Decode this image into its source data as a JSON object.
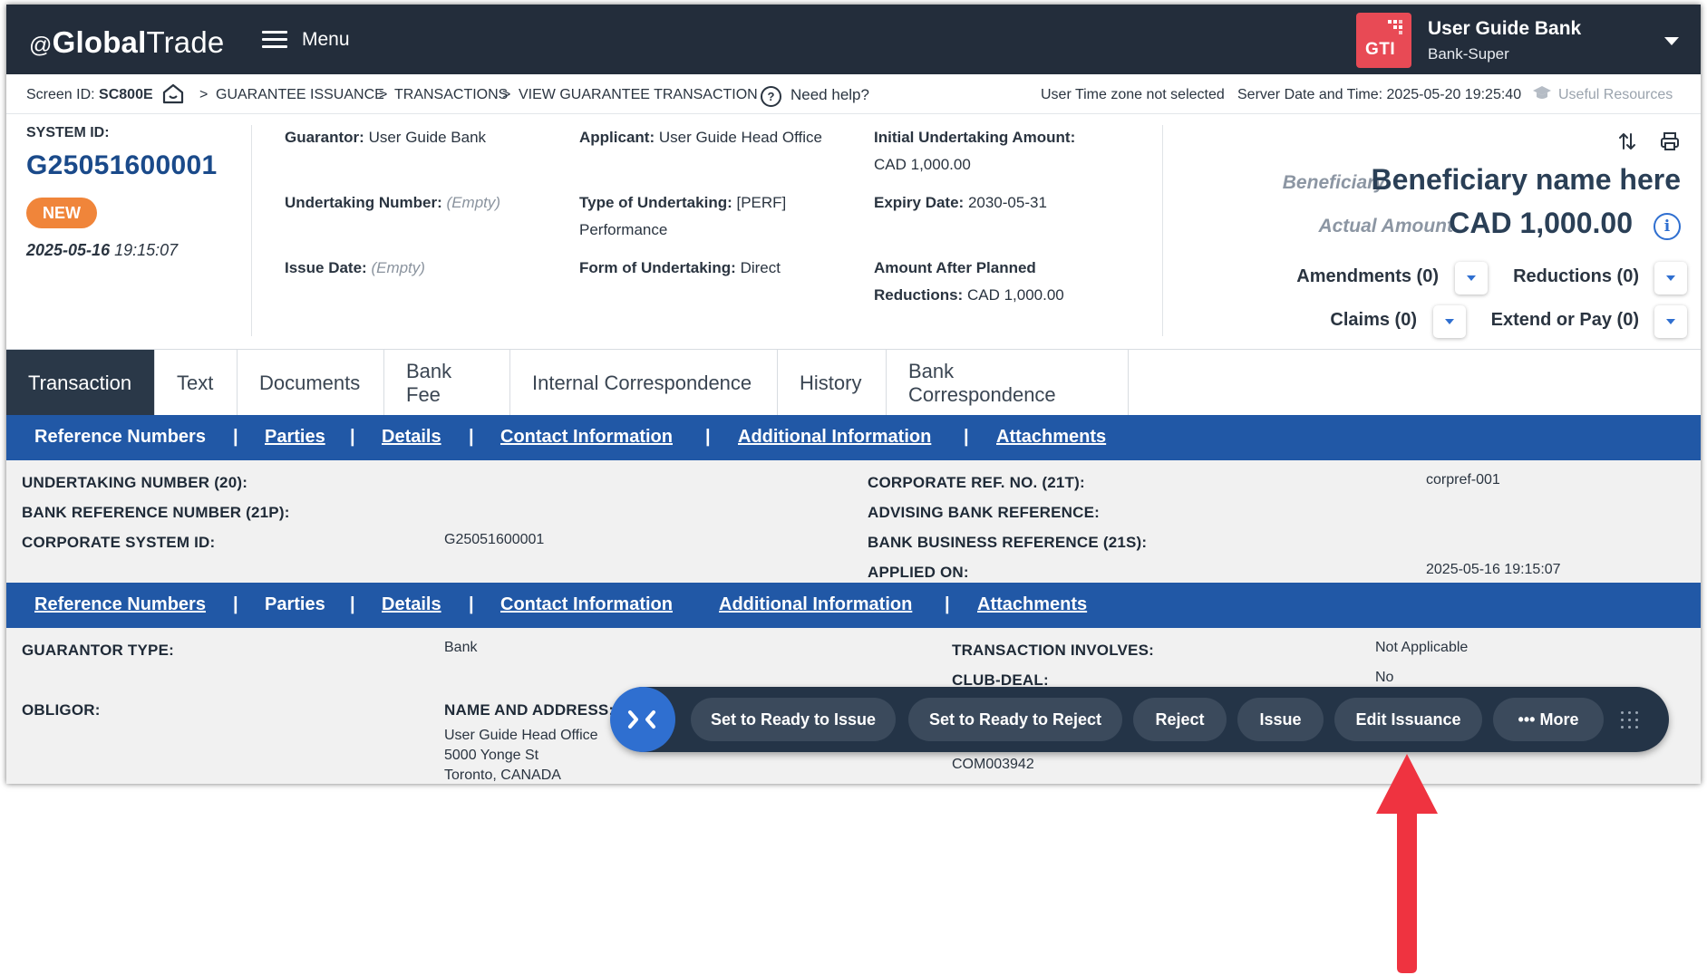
{
  "header": {
    "logo_at": "@",
    "logo_bold": "Global",
    "logo_regular": "Trade",
    "menu_label": "Menu",
    "gti_label": "GTI",
    "user_name": "User Guide Bank",
    "user_role": "Bank-Super"
  },
  "breadcrumb": {
    "screen_id_label": "Screen ID:",
    "screen_id": "SC800E",
    "items": [
      "GUARANTEE ISSUANCE",
      "TRANSACTIONS",
      "VIEW GUARANTEE TRANSACTION"
    ],
    "separator": ">",
    "help": "Need help?",
    "timezone": "User Time zone not selected",
    "server_time": "Server Date and Time: 2025-05-20 19:25:40",
    "resources": "Useful Resources"
  },
  "summary": {
    "system_id_label": "SYSTEM ID:",
    "system_id": "G25051600001",
    "status": "NEW",
    "date": "2025-05-16",
    "time": "19:15:07",
    "guarantor_label": "Guarantor:",
    "guarantor": "User Guide Bank",
    "undertaking_number_label": "Undertaking Number:",
    "undertaking_number": "(Empty)",
    "issue_date_label": "Issue Date:",
    "issue_date": "(Empty)",
    "applicant_label": "Applicant:",
    "applicant": "User Guide Head Office",
    "type_label": "Type of Undertaking:",
    "type_line1": "[PERF]",
    "type_line2": "Performance",
    "form_label": "Form of Undertaking:",
    "form": "Direct",
    "initial_amount_label": "Initial Undertaking Amount:",
    "initial_amount": "CAD 1,000.00",
    "expiry_label": "Expiry Date:",
    "expiry": "2030-05-31",
    "after_planned_label_1": "Amount After Planned",
    "after_planned_label_2": "Reductions:",
    "after_planned": "CAD 1,000.00",
    "beneficiary_label": "Beneficiary",
    "beneficiary": "Beneficiary name here",
    "actual_amount_label": "Actual Amount",
    "actual_amount": "CAD 1,000.00",
    "amendments": "Amendments (0)",
    "reductions": "Reductions (0)",
    "claims": "Claims (0)",
    "extend_or_pay": "Extend or Pay (0)"
  },
  "tabs": [
    "Transaction",
    "Text",
    "Documents",
    "Bank Fee",
    "Internal Correspondence",
    "History",
    "Bank Correspondence"
  ],
  "active_tab": "Transaction",
  "section_nav": [
    "Reference Numbers",
    "Parties",
    "Details",
    "Contact Information",
    "Additional Information",
    "Attachments"
  ],
  "reference_numbers": {
    "undertaking_number_label": "UNDERTAKING NUMBER (20):",
    "undertaking_number": "",
    "bank_reference_label": "BANK REFERENCE NUMBER (21P):",
    "bank_reference": "",
    "corporate_system_id_label": "CORPORATE SYSTEM ID:",
    "corporate_system_id": "G25051600001",
    "corporate_ref_label": "CORPORATE REF. NO. (21T):",
    "corporate_ref": "corpref-001",
    "advising_bank_label": "ADVISING BANK REFERENCE:",
    "advising_bank": "",
    "bank_business_label": "BANK BUSINESS REFERENCE (21S):",
    "bank_business": "",
    "applied_on_label": "APPLIED ON:",
    "applied_on": "2025-05-16 19:15:07"
  },
  "parties": {
    "guarantor_type_label": "GUARANTOR TYPE:",
    "guarantor_type": "Bank",
    "transaction_involves_label": "TRANSACTION INVOLVES:",
    "transaction_involves": "Not Applicable",
    "club_deal_label": "CLUB-DEAL:",
    "club_deal": "No",
    "obligor_label": "OBLIGOR:",
    "name_address_label": "NAME AND ADDRESS:",
    "address_line1": "User Guide Head Office",
    "address_line2": "5000 Yonge St",
    "address_line3": "Toronto, CANADA",
    "obligor_code": "COM003942"
  },
  "action_bar": {
    "buttons": [
      "Set to Ready to Issue",
      "Set to Ready to Reject",
      "Reject",
      "Issue",
      "Edit Issuance",
      "More"
    ]
  },
  "colors": {
    "header_bg": "#232d3b",
    "section_bar": "#2158a6",
    "status_badge": "#f0853a",
    "gti_logo": "#e84a55",
    "annotation_arrow": "#ef3340"
  }
}
